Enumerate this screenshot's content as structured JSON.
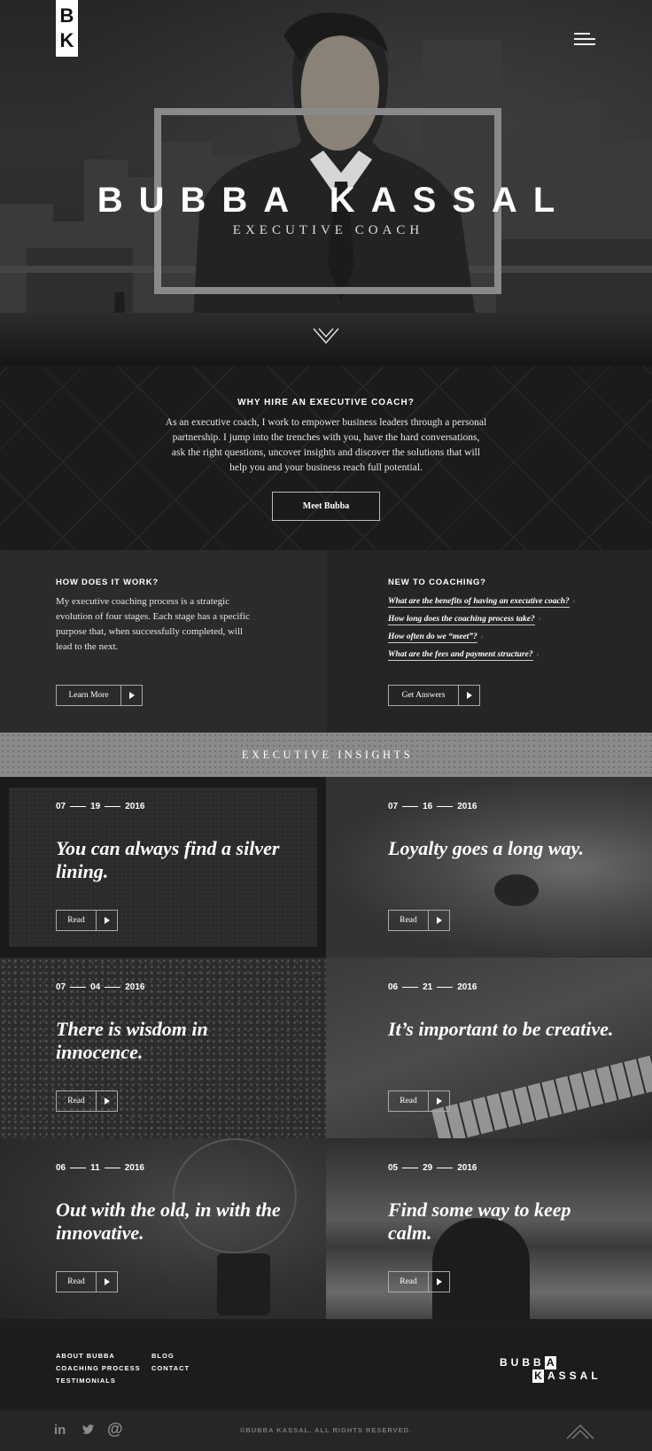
{
  "header": {
    "logo_top": "B",
    "logo_bottom": "K",
    "menu_icon": "hamburger-icon"
  },
  "hero": {
    "name": "BUBBA KASSAL",
    "subtitle": "EXECUTIVE COACH",
    "scroll_icon": "chevron-down-icon"
  },
  "why": {
    "title": "WHY HIRE AN EXECUTIVE COACH?",
    "body": "As an executive coach, I work to empower business leaders through a personal partnership. I jump into the trenches with you, have the hard conversations, ask the right questions, uncover insights and discover the solutions that will help you and your business reach full potential.",
    "button": "Meet Bubba"
  },
  "how": {
    "title": "HOW DOES IT WORK?",
    "body": "My executive coaching process is a strategic evolution of four stages. Each stage has a specific purpose that, when successfully completed, will lead to the next.",
    "button": "Learn More"
  },
  "new_to_coaching": {
    "title": "NEW TO COACHING?",
    "questions": [
      "What are the benefits of having an executive coach?",
      "How long does the coaching process take?",
      "How often do we “meet”?",
      "What are the fees and payment structure?"
    ],
    "button": "Get Answers"
  },
  "insights": {
    "title": "EXECUTIVE INSIGHTS",
    "read_label": "Read",
    "cards": [
      {
        "month": "07",
        "day": "19",
        "year": "2016",
        "title": "You can always find a silver lining."
      },
      {
        "month": "07",
        "day": "16",
        "year": "2016",
        "title": "Loyalty goes a long way."
      },
      {
        "month": "07",
        "day": "04",
        "year": "2016",
        "title": "There is wisdom in innocence."
      },
      {
        "month": "06",
        "day": "21",
        "year": "2016",
        "title": "It’s important to be creative."
      },
      {
        "month": "06",
        "day": "11",
        "year": "2016",
        "title": "Out with the old, in with the innovative."
      },
      {
        "month": "05",
        "day": "29",
        "year": "2016",
        "title": "Find some way to keep calm."
      }
    ]
  },
  "footer": {
    "links_col1": [
      "ABOUT BUBBA",
      "COACHING PROCESS",
      "TESTIMONIALS"
    ],
    "links_col2": [
      "BLOG",
      "CONTACT"
    ],
    "logo_line1": "BUBBA",
    "logo_line2": "KASSAL",
    "social": [
      {
        "icon": "linkedin-icon",
        "glyph": "in"
      },
      {
        "icon": "twitter-icon",
        "glyph": "🐦"
      },
      {
        "icon": "email-icon",
        "glyph": "@"
      }
    ],
    "copyright": "©BUBBA KASSAL. ALL RIGHTS RESERVED.",
    "back_to_top_icon": "back-to-top-icon"
  }
}
